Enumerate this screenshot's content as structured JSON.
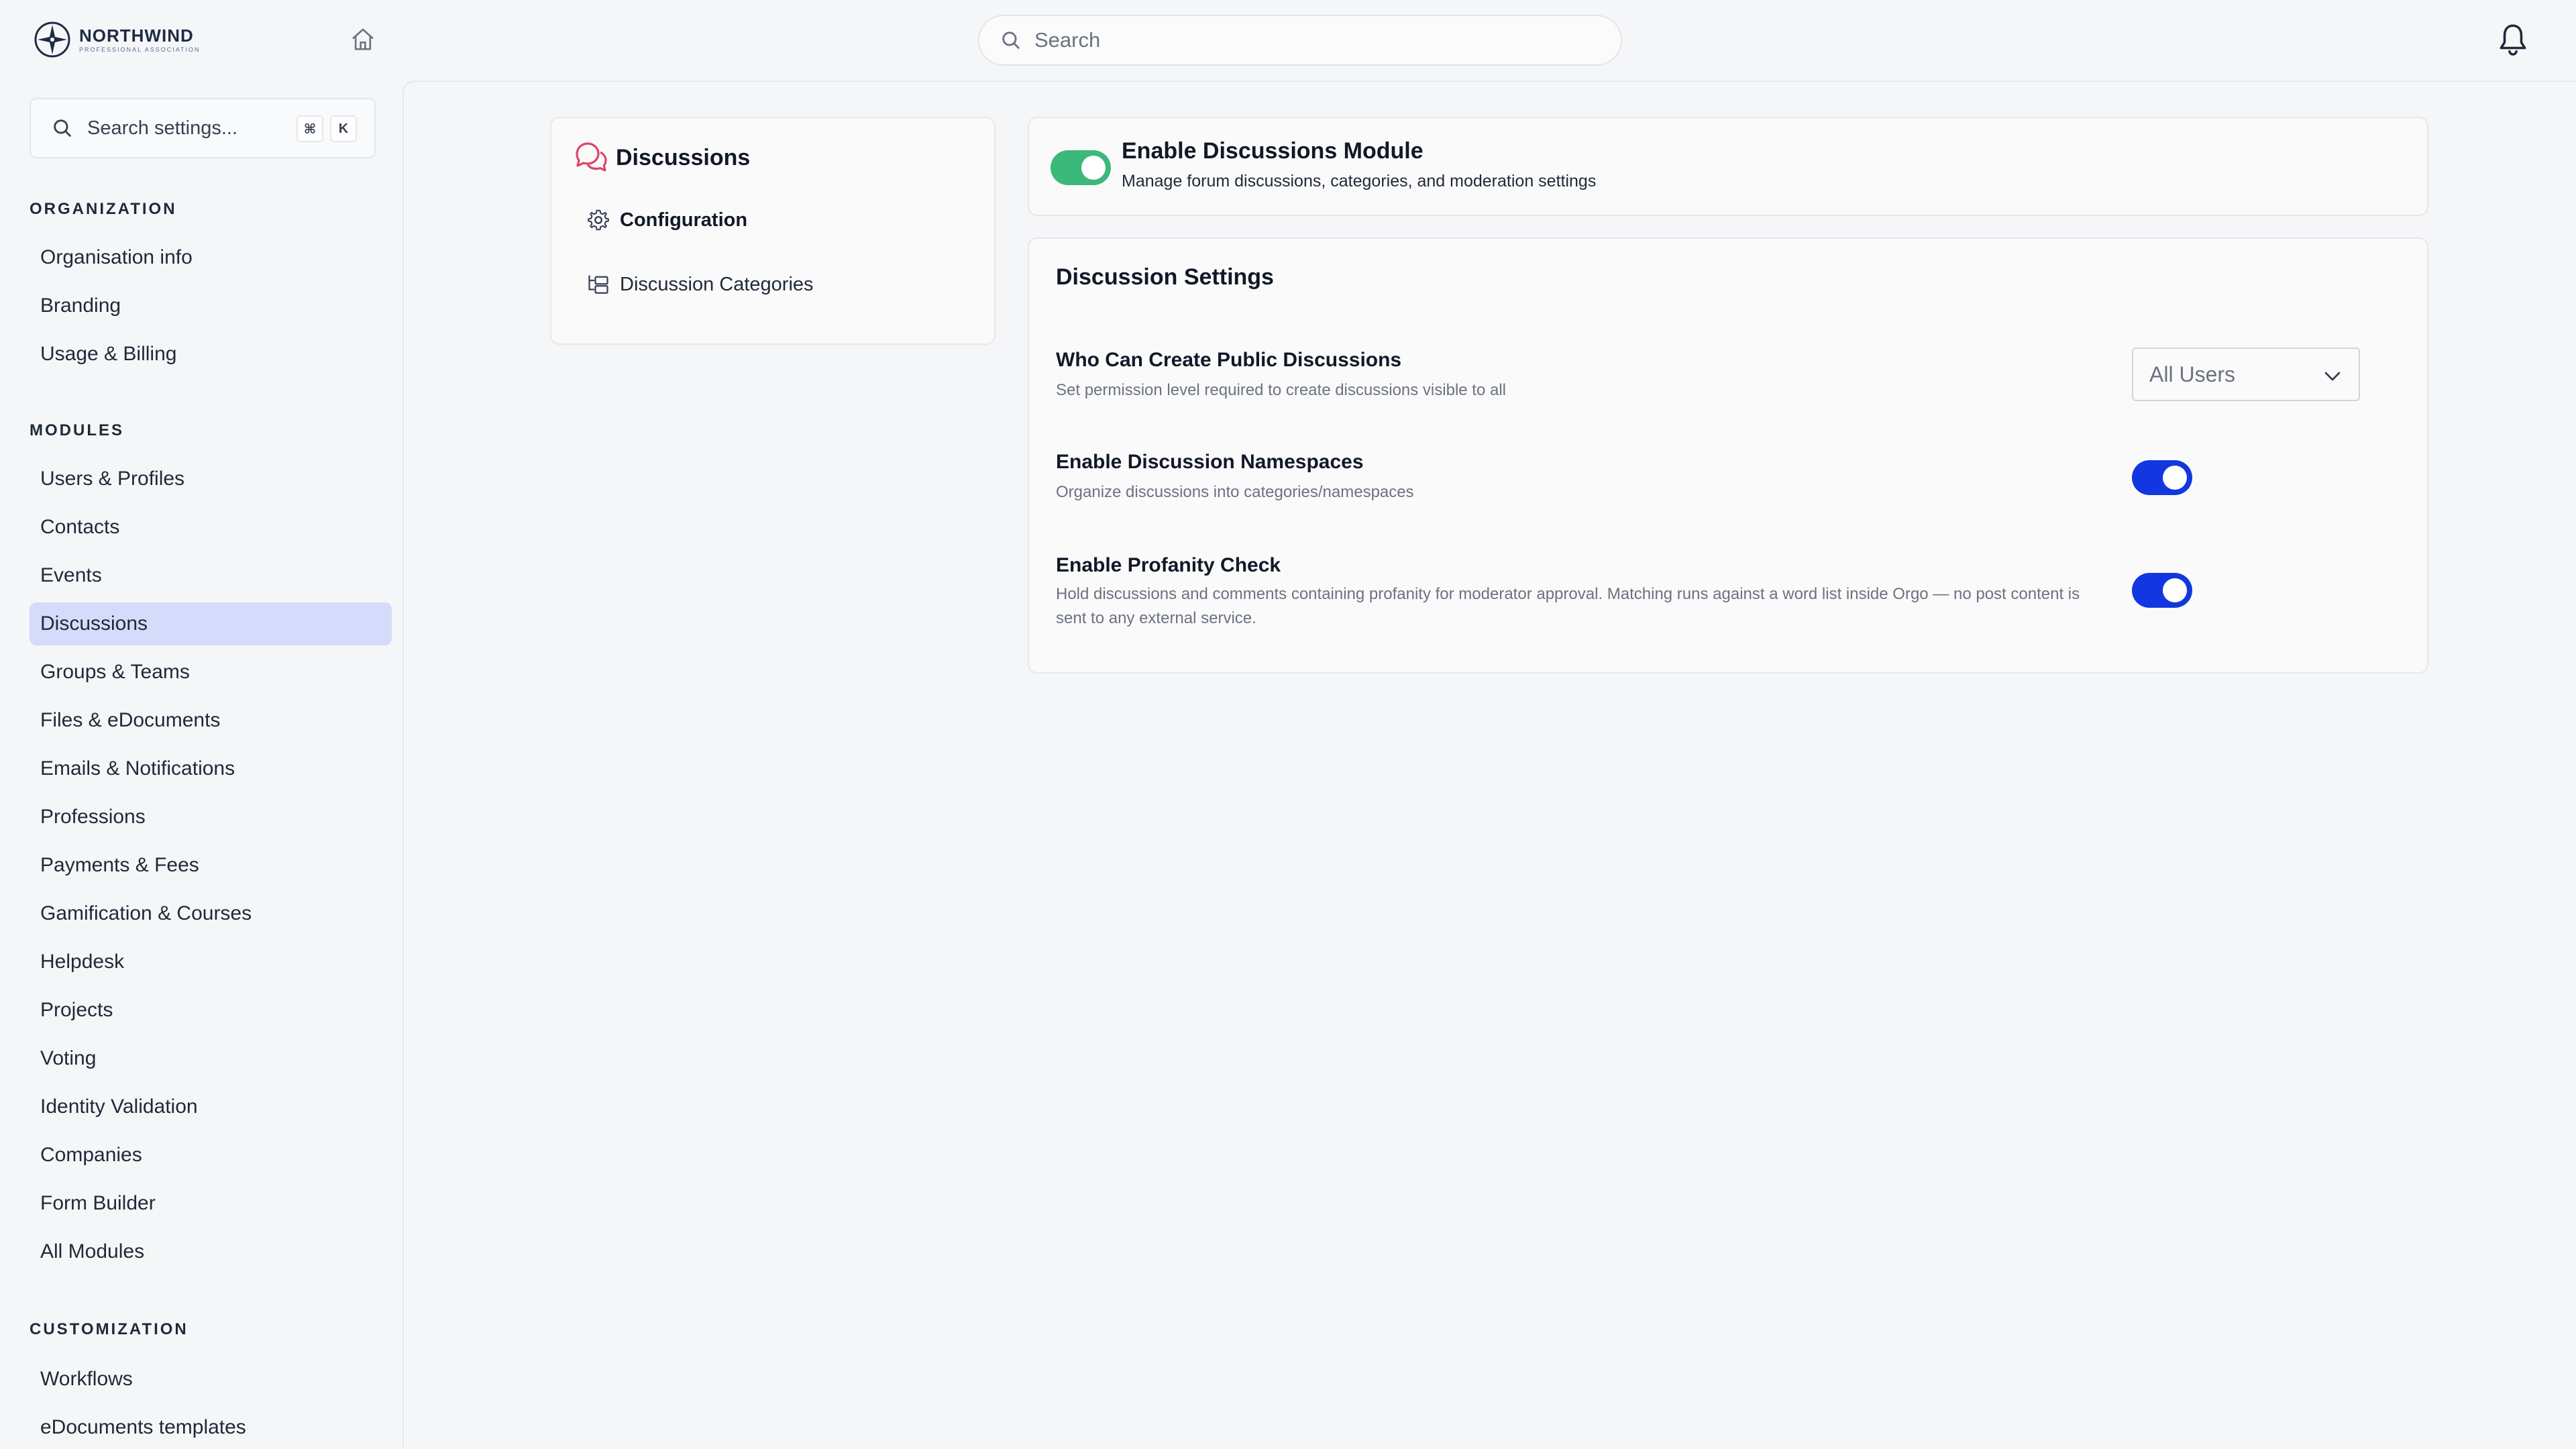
{
  "header": {
    "logo_name": "NORTHWIND",
    "logo_subtitle": "PROFESSIONAL ASSOCIATION",
    "search_placeholder": "Search"
  },
  "sidebar": {
    "search_placeholder": "Search settings...",
    "shortcut_keys": [
      "⌘",
      "K"
    ],
    "sections": [
      {
        "title": "ORGANIZATION",
        "items": [
          "Organisation info",
          "Branding",
          "Usage & Billing"
        ]
      },
      {
        "title": "MODULES",
        "items": [
          "Users & Profiles",
          "Contacts",
          "Events",
          "Discussions",
          "Groups & Teams",
          "Files & eDocuments",
          "Emails & Notifications",
          "Professions",
          "Payments & Fees",
          "Gamification & Courses",
          "Helpdesk",
          "Projects",
          "Voting",
          "Identity Validation",
          "Companies",
          "Form Builder",
          "All Modules"
        ]
      },
      {
        "title": "CUSTOMIZATION",
        "items": [
          "Workflows",
          "eDocuments templates"
        ]
      }
    ],
    "active_item": "Discussions"
  },
  "subnav": {
    "title": "Discussions",
    "items": [
      {
        "label": "Configuration",
        "icon": "gear-icon",
        "active": true
      },
      {
        "label": "Discussion Categories",
        "icon": "folder-tree-icon",
        "active": false
      }
    ]
  },
  "module": {
    "title": "Enable Discussions Module",
    "description": "Manage forum discussions, categories, and moderation settings",
    "enabled": true
  },
  "settings": {
    "title": "Discussion Settings",
    "rows": [
      {
        "title": "Who Can Create Public Discussions",
        "description": "Set permission level required to create discussions visible to all",
        "control": "select",
        "value": "All Users"
      },
      {
        "title": "Enable Discussion Namespaces",
        "description": "Organize discussions into categories/namespaces",
        "control": "toggle",
        "enabled": true
      },
      {
        "title": "Enable Profanity Check",
        "description": "Hold discussions and comments containing profanity for moderator approval. Matching runs against a word list inside Orgo — no post content is sent to any external service.",
        "control": "toggle",
        "enabled": true
      }
    ]
  },
  "colors": {
    "accent_blue": "#1237e0",
    "module_green": "#3cb87a",
    "active_nav_bg": "#d4dbfb",
    "discussions_icon": "#e0426a"
  }
}
